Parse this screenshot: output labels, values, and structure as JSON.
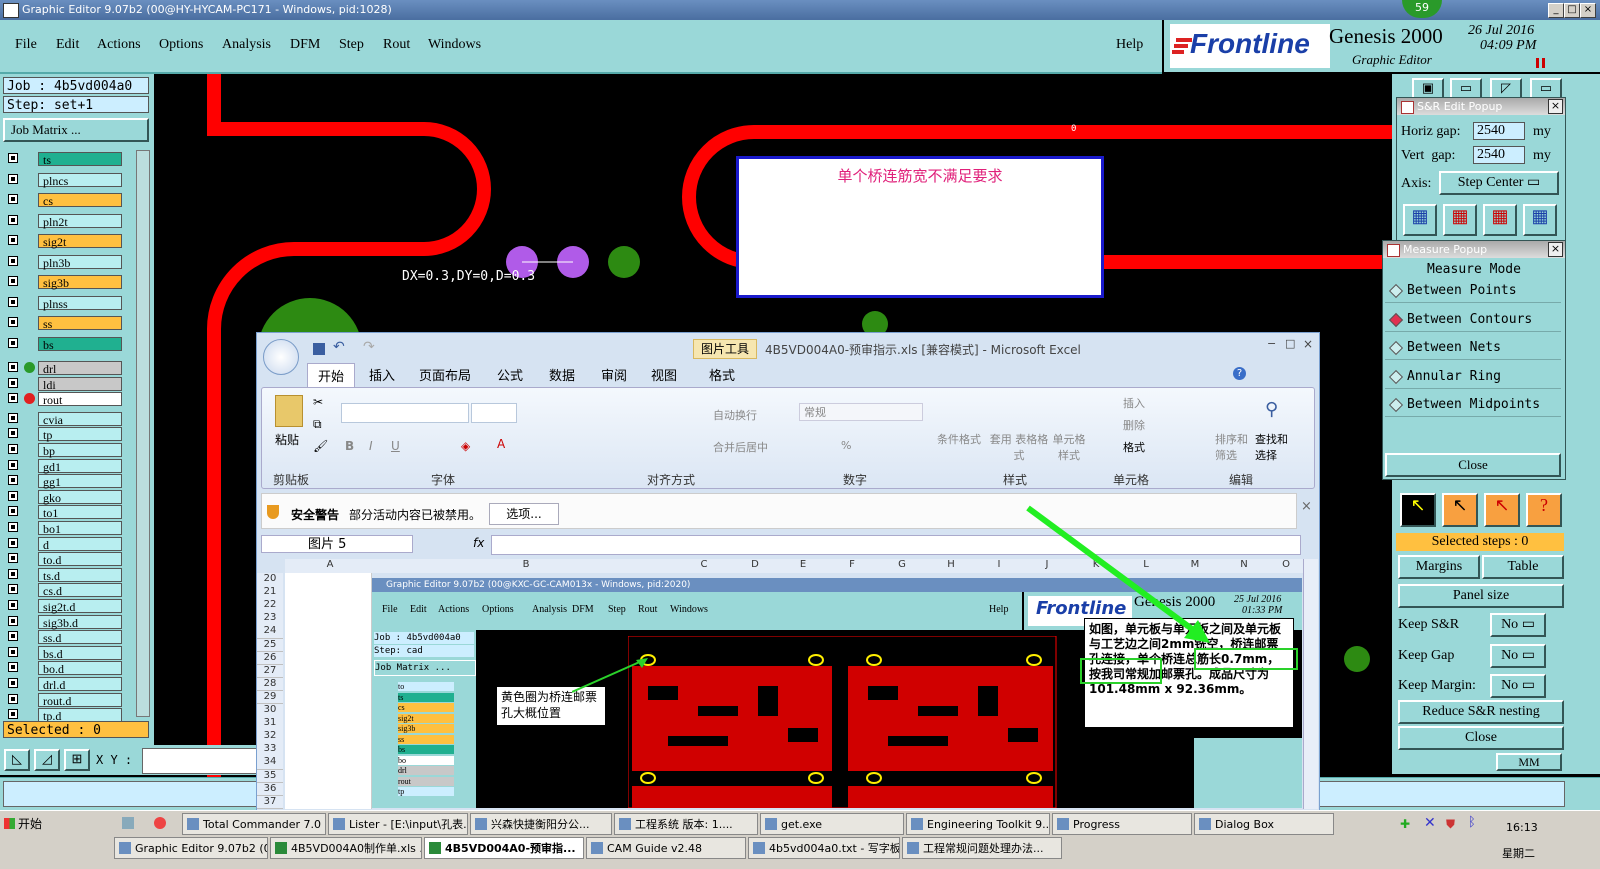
{
  "window": {
    "title": "Graphic Editor 9.07b2 (00@HY-HYCAM-PC171 - Windows, pid:1028)",
    "badge": "59",
    "min": "_",
    "max": "□",
    "close": "×"
  },
  "menu": {
    "file": "File",
    "edit": "Edit",
    "actions": "Actions",
    "options": "Options",
    "analysis": "Analysis",
    "dfm": "DFM",
    "step": "Step",
    "rout": "Rout",
    "windows": "Windows",
    "help": "Help"
  },
  "brand": {
    "logo": "Frontline",
    "product": "Genesis 2000",
    "sub": "Graphic Editor",
    "date": "26 Jul 2016",
    "time": "04:09 PM"
  },
  "left": {
    "job": "Job : 4b5vd004a0",
    "step": "Step: set+1",
    "matrix": "Job Matrix ...",
    "selected": "Selected : 0",
    "xy_label": "X Y :",
    "layers": [
      {
        "name": "ts",
        "color": "#20b090"
      },
      {
        "name": "plncs",
        "color": "#b8eef0"
      },
      {
        "name": "cs",
        "color": "#ffc040"
      },
      {
        "name": "pln2t",
        "color": "#b8eef0"
      },
      {
        "name": "sig2t",
        "color": "#ffc040"
      },
      {
        "name": "pln3b",
        "color": "#b8eef0"
      },
      {
        "name": "sig3b",
        "color": "#ffc040"
      },
      {
        "name": "plnss",
        "color": "#b8eef0"
      },
      {
        "name": "ss",
        "color": "#ffc040"
      },
      {
        "name": "bs",
        "color": "#20b090"
      },
      {
        "name": "drl",
        "color": "#c8c8c8"
      },
      {
        "name": "ldi",
        "color": "#c8c8c8"
      },
      {
        "name": "rout",
        "color": "#ffffff"
      },
      {
        "name": "cvia",
        "color": "#b8eef0"
      },
      {
        "name": "tp",
        "color": "#b8eef0"
      },
      {
        "name": "bp",
        "color": "#b8eef0"
      },
      {
        "name": "gd1",
        "color": "#b8eef0"
      },
      {
        "name": "gg1",
        "color": "#b8eef0"
      },
      {
        "name": "gko",
        "color": "#b8eef0"
      },
      {
        "name": "to1",
        "color": "#b8eef0"
      },
      {
        "name": "bo1",
        "color": "#b8eef0"
      },
      {
        "name": "d",
        "color": "#b8eef0"
      },
      {
        "name": "to.d",
        "color": "#b8eef0"
      },
      {
        "name": "ts.d",
        "color": "#b8eef0"
      },
      {
        "name": "cs.d",
        "color": "#b8eef0"
      },
      {
        "name": "sig2t.d",
        "color": "#b8eef0"
      },
      {
        "name": "sig3b.d",
        "color": "#b8eef0"
      },
      {
        "name": "ss.d",
        "color": "#b8eef0"
      },
      {
        "name": "bs.d",
        "color": "#b8eef0"
      },
      {
        "name": "bo.d",
        "color": "#b8eef0"
      },
      {
        "name": "drl.d",
        "color": "#b8eef0"
      },
      {
        "name": "rout.d",
        "color": "#b8eef0"
      },
      {
        "name": "tp.d",
        "color": "#b8eef0"
      }
    ]
  },
  "canvas": {
    "measure": "DX=0.3,DY=0,D=0.3",
    "note": "单个桥连筋宽不满足要求",
    "zero": "0"
  },
  "sr": {
    "title": "S&R Edit Popup",
    "horiz_label": "Horiz gap:",
    "horiz_val": "2540",
    "horiz_unit": "my",
    "vert_label": "Vert  gap:",
    "vert_val": "2540",
    "vert_unit": "my",
    "axis_label": "Axis:",
    "axis_val": "Step Center"
  },
  "measure": {
    "title": "Measure Popup",
    "mode": "Measure Mode",
    "items": [
      "Between Points",
      "Between Contours",
      "Between Nets",
      "Annular Ring",
      "Between Midpoints"
    ],
    "close": "Close"
  },
  "right": {
    "selected_steps": "Selected steps : 0",
    "margins": "Margins",
    "table": "Table",
    "panel_size": "Panel size",
    "keep_sr": "Keep S&R",
    "keep_gap": "Keep Gap",
    "keep_margin": "Keep Margin:",
    "no": "No",
    "reduce": "Reduce S&R nesting",
    "close": "Close",
    "units": "MM"
  },
  "excel": {
    "tools": "图片工具",
    "title": "4B5VD004A0-预审指示.xls  [兼容模式] - Microsoft Excel",
    "tabs": [
      "开始",
      "插入",
      "页面布局",
      "公式",
      "数据",
      "审阅",
      "视图",
      "格式"
    ],
    "paste": "粘贴",
    "groups": {
      "clipboard": "剪贴板",
      "font": "字体",
      "align": "对齐方式",
      "number": "数字",
      "style": "样式",
      "cells": "单元格",
      "edit": "编辑"
    },
    "wrap": "自动换行",
    "merge": "合并后居中",
    "numfmt": "常规",
    "cond": "条件格式",
    "table_fmt": "套用 表格格式",
    "cell_style": "单元格 样式",
    "insert": "插入",
    "delete": "删除",
    "format": "格式",
    "sort": "排序和 筛选",
    "find": "查找和 选择",
    "security": "安全警告",
    "security_msg": "部分活动内容已被禁用。",
    "options": "选项...",
    "namebox": "图片 5",
    "fx": "fx",
    "cols": [
      "A",
      "B",
      "C",
      "D",
      "E",
      "F",
      "G",
      "H",
      "I",
      "J",
      "K",
      "L",
      "M",
      "N",
      "O"
    ],
    "rows": [
      "20",
      "21",
      "22",
      "23",
      "24",
      "25",
      "26",
      "27",
      "28",
      "29",
      "30",
      "31",
      "32",
      "33",
      "34",
      "35",
      "36",
      "37"
    ]
  },
  "inner": {
    "title": "Graphic Editor 9.07b2 (00@KXC-GC-CAM013x - Windows, pid:2020)",
    "menu": [
      "File",
      "Edit",
      "Actions",
      "Options",
      "Analysis",
      "DFM",
      "Step",
      "Rout",
      "Windows"
    ],
    "help": "Help",
    "logo": "Frontline",
    "product": "Genesis 2000",
    "date": "25 Jul 2016",
    "time": "01:33 PM",
    "job": "Job : 4b5vd004a0",
    "step": "Step: cad",
    "matrix": "Job Matrix ...",
    "layers": [
      "to",
      "ts",
      "cs",
      "sig2t",
      "sig3b",
      "ss",
      "bs",
      "bo",
      "drl",
      "rout",
      "tp"
    ],
    "callout1": "黄色圈为桥连邮票孔大概位置",
    "callout2": "如图，单元板与单元板之间及单元板与工艺边之间2mm铣空，桥连邮票孔连接，单个桥连总筋长0.7mm，按我司常规加邮票孔。成品尺寸为101.48mm x 92.36mm。"
  },
  "taskbar": {
    "start": "开始",
    "row1": [
      "Total Commander 7.0 ...",
      "Lister - [E:\\input\\孔表...",
      "兴森快捷衡阳分公...",
      "工程系统  版本: 1....",
      "get.exe",
      "Engineering Toolkit 9....",
      "Progress",
      "Dialog Box"
    ],
    "row2": [
      "Graphic Editor 9.07b2 (0...",
      "4B5VD004A0制作单.xls ...",
      "4B5VD004A0-预审指...",
      "CAM  Guide v2.48",
      "4b5vd004a0.txt - 写字板",
      "工程常规问题处理办法..."
    ],
    "clock": "16:13",
    "weekday": "星期二"
  }
}
